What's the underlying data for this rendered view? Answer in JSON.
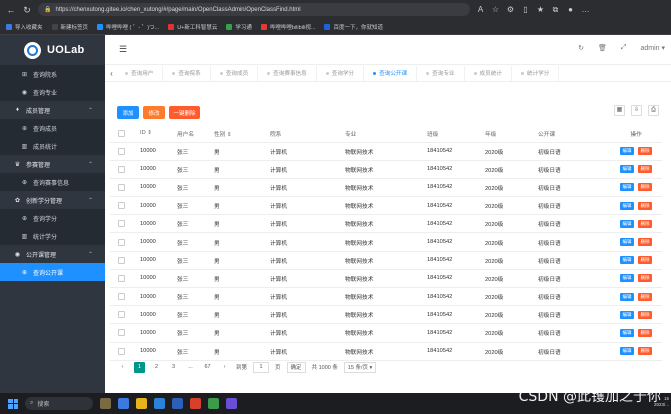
{
  "browser": {
    "url": "https://chenxutong.gitee.io/chen_xutong/#/page/main/OpenClassAdmin/OpenClassFind.html",
    "bookmarks": [
      "导入收藏夹",
      "新建标签页",
      "哔哩哔哩 ( ゜- ゜)つ...",
      "U+新工科智慧云",
      "学习通",
      "哔哩哔哩bilibili视...",
      "百度一下，你就知道"
    ]
  },
  "app": {
    "logo": "UOLab",
    "user": "admin ▾"
  },
  "sidebar": {
    "items": [
      {
        "label": "查询院系",
        "type": "sub",
        "icon": "⊞"
      },
      {
        "label": "查询专业",
        "type": "sub",
        "icon": "◉"
      },
      {
        "label": "成员管理",
        "type": "group",
        "icon": "♦"
      },
      {
        "label": "查询成员",
        "type": "sub",
        "icon": "⊕"
      },
      {
        "label": "成员统计",
        "type": "sub",
        "icon": "▥"
      },
      {
        "label": "参赛管理",
        "type": "group",
        "icon": "♛"
      },
      {
        "label": "查询赛事信息",
        "type": "sub",
        "icon": "⊕"
      },
      {
        "label": "创新学分管理",
        "type": "group",
        "icon": "✿"
      },
      {
        "label": "查询学分",
        "type": "sub",
        "icon": "⊕"
      },
      {
        "label": "统计学分",
        "type": "sub",
        "icon": "▥"
      },
      {
        "label": "公开课管理",
        "type": "group",
        "icon": "◉"
      },
      {
        "label": "查询公开课",
        "type": "sub",
        "icon": "⊕",
        "active": true
      }
    ]
  },
  "tabs": [
    "查询用户",
    "查询院系",
    "查询成员",
    "查询赛事信息",
    "查询学分",
    "查询公开课",
    "查询专业",
    "成员统计",
    "统计学分"
  ],
  "active_tab": 5,
  "toolbar": {
    "add": "添加",
    "edit": "修改",
    "delete": "一键删除"
  },
  "table": {
    "headers": [
      "",
      "ID ⇕",
      "用户名",
      "性别 ⇕",
      "院系",
      "专业",
      "班级",
      "年级",
      "公开课",
      "操作"
    ],
    "row": [
      "10000",
      "张三",
      "男",
      "计算机",
      "物联网技术",
      "18410542",
      "2020级",
      "初级日语"
    ],
    "row_count": 12,
    "edit_label": "编辑",
    "delete_label": "删除"
  },
  "pager": {
    "pages": [
      "1",
      "2",
      "3",
      "...",
      "67"
    ],
    "goto_label": "到第",
    "goto_value": "1",
    "page_unit": "页",
    "confirm": "确定",
    "total": "共 1000 条",
    "per_page": "15 条/页 ▾"
  },
  "taskbar": {
    "search": "搜索"
  },
  "clock": {
    "time": "15",
    "date": "2023/..."
  },
  "watermark": "CSDN @此镬加之于你"
}
